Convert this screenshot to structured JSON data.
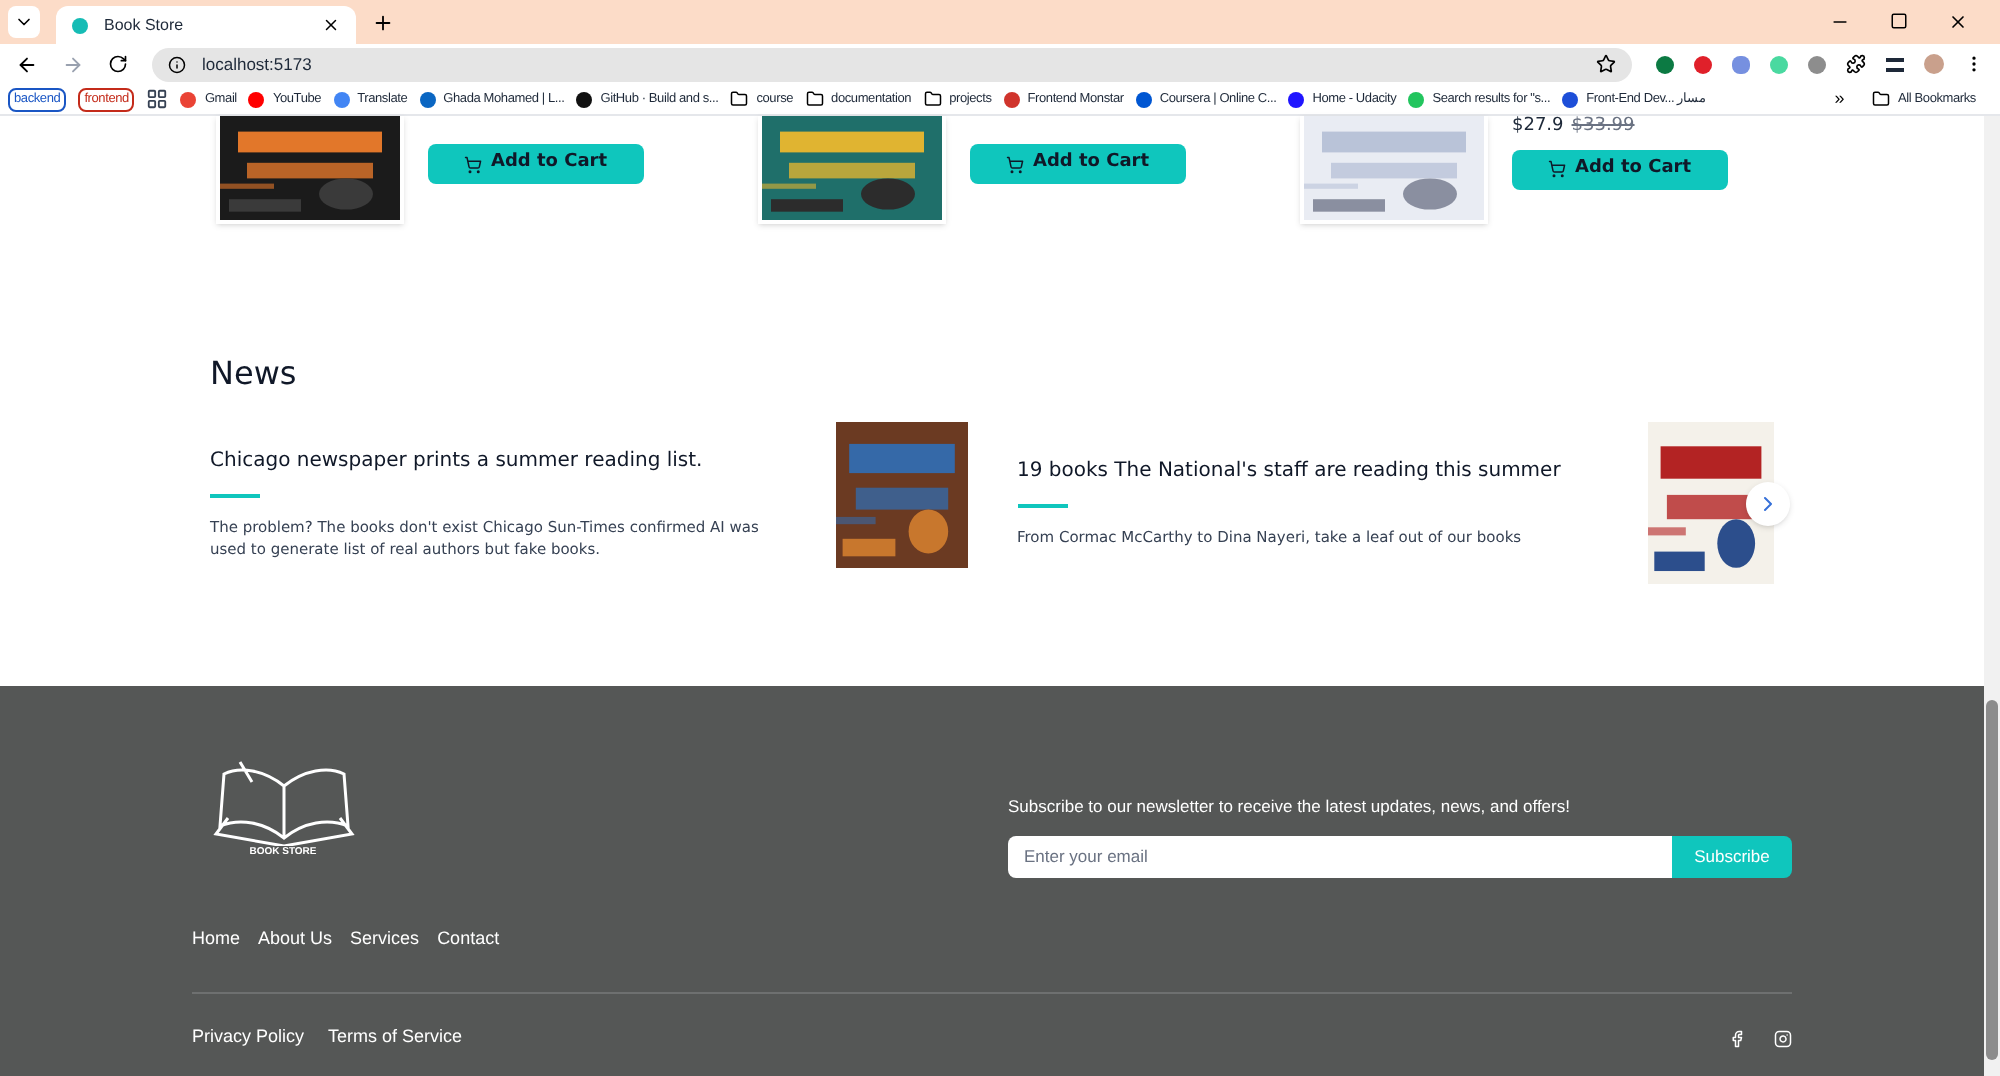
{
  "browser": {
    "tab": {
      "title": "Book Store"
    },
    "address": "localhost:5173",
    "bookmarks": [
      {
        "kind": "tag",
        "label": "backend",
        "color": "#1a56c4"
      },
      {
        "kind": "tag",
        "label": "frontend",
        "color": "#c42b1a"
      },
      {
        "kind": "apps"
      },
      {
        "kind": "site",
        "label": "Gmail",
        "color": "#ea4335"
      },
      {
        "kind": "site",
        "label": "YouTube",
        "color": "#ff0000"
      },
      {
        "kind": "site",
        "label": "Translate",
        "color": "#4285f4"
      },
      {
        "kind": "site",
        "label": "Ghada Mohamed | L...",
        "color": "#0a66c2"
      },
      {
        "kind": "site",
        "label": "GitHub · Build and s...",
        "color": "#111111"
      },
      {
        "kind": "folder",
        "label": "course"
      },
      {
        "kind": "folder",
        "label": "documentation"
      },
      {
        "kind": "folder",
        "label": "projects"
      },
      {
        "kind": "site",
        "label": "Frontend Monstar",
        "color": "#d0342c"
      },
      {
        "kind": "site",
        "label": "Coursera | Online C...",
        "color": "#0056d2"
      },
      {
        "kind": "site",
        "label": "Home - Udacity",
        "color": "#2015ff"
      },
      {
        "kind": "site",
        "label": "Search results for \"s...",
        "color": "#22c55e"
      },
      {
        "kind": "site",
        "label": "Front-End Dev... مسار",
        "color": "#1d4ed8"
      }
    ],
    "more": "»",
    "all_bookmarks": "All Bookmarks"
  },
  "books": [
    {
      "button": "Add to Cart"
    },
    {
      "button": "Add to Cart"
    },
    {
      "price": "$27.9",
      "old_price": "$33.99",
      "button": "Add to Cart"
    }
  ],
  "news": {
    "title": "News",
    "items": [
      {
        "title": "Chicago newspaper prints a summer reading list.",
        "text": "The problem? The books don't exist Chicago Sun-Times confirmed AI was used to generate list of real authors but fake books."
      },
      {
        "title": "19 books The National's staff are reading this summer",
        "text": "From Cormac McCarthy to Dina Nayeri, take a leaf out of our books"
      }
    ]
  },
  "footer": {
    "logo_text": "BOOK STORE",
    "newsletter": "Subscribe to our newsletter to receive the latest updates, news, and offers!",
    "email_placeholder": "Enter your email",
    "subscribe": "Subscribe",
    "links": [
      "Home",
      "About Us",
      "Services",
      "Contact"
    ],
    "legal": [
      "Privacy Policy",
      "Terms of Service"
    ]
  }
}
